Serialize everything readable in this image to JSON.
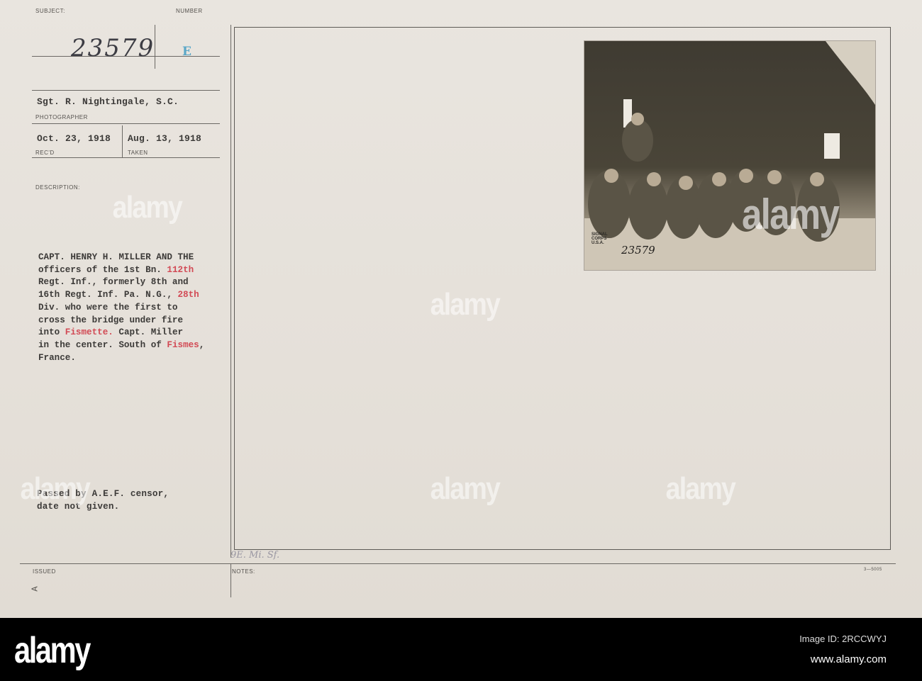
{
  "card": {
    "subject_label": "SUBJECT:",
    "number_label": "NUMBER",
    "subject_number": "23579",
    "number_letter": "E",
    "photographer": "Sgt. R. Nightingale, S.C.",
    "photographer_label": "PHOTOGRAPHER",
    "received_date": "Oct. 23, 1918",
    "received_label": "REC'D",
    "taken_date": "Aug. 13, 1918",
    "taken_label": "TAKEN",
    "description_label": "DESCRIPTION:",
    "description_lines": [
      [
        {
          "t": "CAPT. HENRY H. MILLER AND THE"
        }
      ],
      [
        {
          "t": "officers of the 1st Bn. "
        },
        {
          "t": "112th",
          "red": true
        }
      ],
      [
        {
          "t": "Regt. Inf., formerly 8th and"
        }
      ],
      [
        {
          "t": "16th Regt. Inf. Pa. N.G., "
        },
        {
          "t": "28th",
          "red": true
        }
      ],
      [
        {
          "t": "Div. who were the first to"
        }
      ],
      [
        {
          "t": "cross the bridge under fire"
        }
      ],
      [
        {
          "t": "into "
        },
        {
          "t": "Fismette.",
          "red": true
        },
        {
          "t": " Capt. Miller"
        }
      ],
      [
        {
          "t": "in the center. South of "
        },
        {
          "t": "Fismes",
          "red": true
        },
        {
          "t": ","
        }
      ],
      [
        {
          "t": "France."
        }
      ]
    ],
    "censor_line_1": "Passed by A.E.F. censor,",
    "censor_line_2": "date not given.",
    "issued_label": "ISSUED",
    "issued_mark": "A",
    "notes_label": "NOTES:",
    "notes_handwriting": "9E. Mi. Sf.",
    "form_number": "3—5005"
  },
  "photo": {
    "stamp_text": "SIGNAL CORPS U.S.A.",
    "photo_number": "23579",
    "watermark": "alamy"
  },
  "banner": {
    "logo": "alamy",
    "image_id": "Image ID: 2RCCWYJ",
    "url": "www.alamy.com"
  },
  "watermark_text": "alamy",
  "colors": {
    "red_type": "#d24a55",
    "blue_stamp": "#5aa7c8",
    "card": "#e6e1da"
  }
}
